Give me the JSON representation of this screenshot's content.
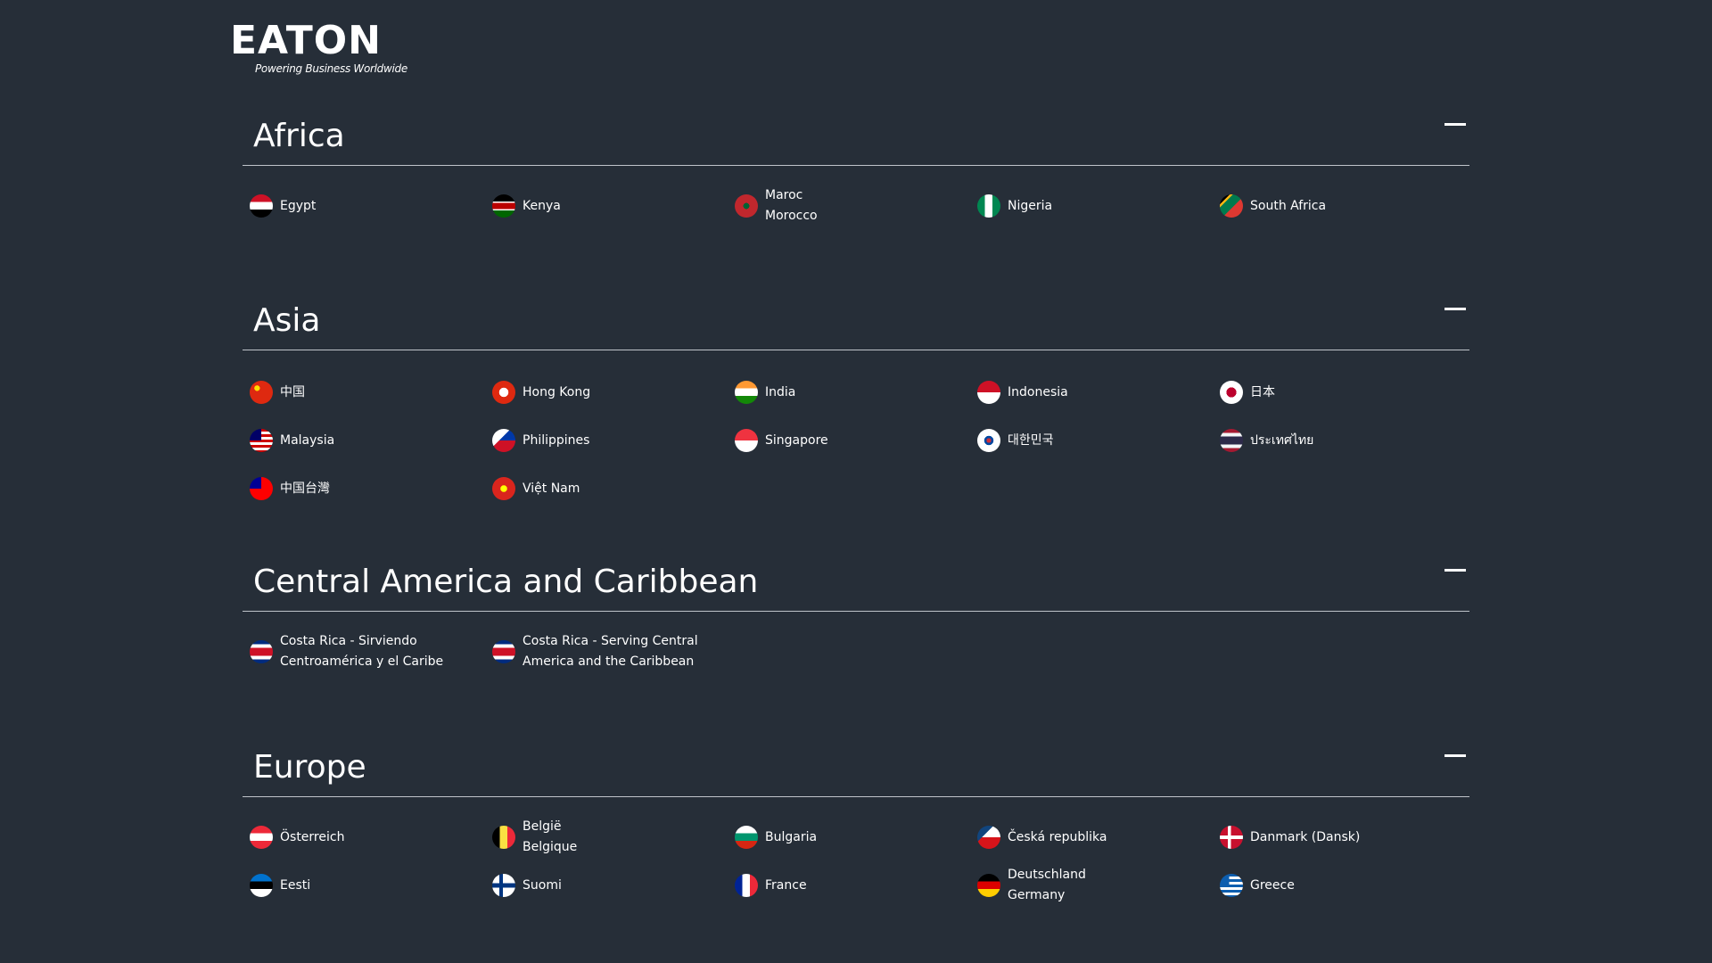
{
  "brand": {
    "name": "EATON",
    "tagline": "Powering Business Worldwide"
  },
  "regions": [
    {
      "title": "Africa",
      "countries": [
        {
          "name": "Egypt",
          "flag": "egypt-flag"
        },
        {
          "name": "Kenya",
          "flag": "kenya-flag"
        },
        {
          "name": "Maroc\nMorocco",
          "flag": "morocco-flag"
        },
        {
          "name": "Nigeria",
          "flag": "nigeria-flag"
        },
        {
          "name": "South Africa",
          "flag": "south-africa-flag"
        }
      ]
    },
    {
      "title": "Asia",
      "countries": [
        {
          "name": "中国",
          "flag": "china-flag"
        },
        {
          "name": "Hong Kong",
          "flag": "hong-kong-flag"
        },
        {
          "name": "India",
          "flag": "india-flag"
        },
        {
          "name": "Indonesia",
          "flag": "indonesia-flag"
        },
        {
          "name": "日本",
          "flag": "japan-flag"
        },
        {
          "name": "Malaysia",
          "flag": "malaysia-flag"
        },
        {
          "name": "Philippines",
          "flag": "philippines-flag"
        },
        {
          "name": "Singapore",
          "flag": "singapore-flag"
        },
        {
          "name": "대한민국",
          "flag": "korea-flag"
        },
        {
          "name": "ประเทศไทย",
          "flag": "thailand-flag"
        },
        {
          "name": "中国台灣",
          "flag": "taiwan-flag"
        },
        {
          "name": "Việt Nam",
          "flag": "vietnam-flag"
        }
      ]
    },
    {
      "title": "Central America and Caribbean",
      "countries": [
        {
          "name": "Costa Rica - Sirviendo\nCentroamérica y el Caribe",
          "flag": "costa-rica-flag"
        },
        {
          "name": "Costa Rica - Serving Central\nAmerica and the Caribbean",
          "flag": "costa-rica-flag"
        }
      ]
    },
    {
      "title": "Europe",
      "countries": [
        {
          "name": "Österreich",
          "flag": "austria-flag"
        },
        {
          "name": "België\nBelgique",
          "flag": "belgium-flag"
        },
        {
          "name": "Bulgaria",
          "flag": "bulgaria-flag"
        },
        {
          "name": "Česká republika",
          "flag": "czech-flag"
        },
        {
          "name": "Danmark (Dansk)",
          "flag": "denmark-flag"
        },
        {
          "name": "Eesti",
          "flag": "estonia-flag"
        },
        {
          "name": "Suomi",
          "flag": "finland-flag"
        },
        {
          "name": "France",
          "flag": "france-flag"
        },
        {
          "name": "Deutschland\nGermany",
          "flag": "germany-flag"
        },
        {
          "name": "Greece",
          "flag": "greece-flag"
        }
      ]
    }
  ]
}
